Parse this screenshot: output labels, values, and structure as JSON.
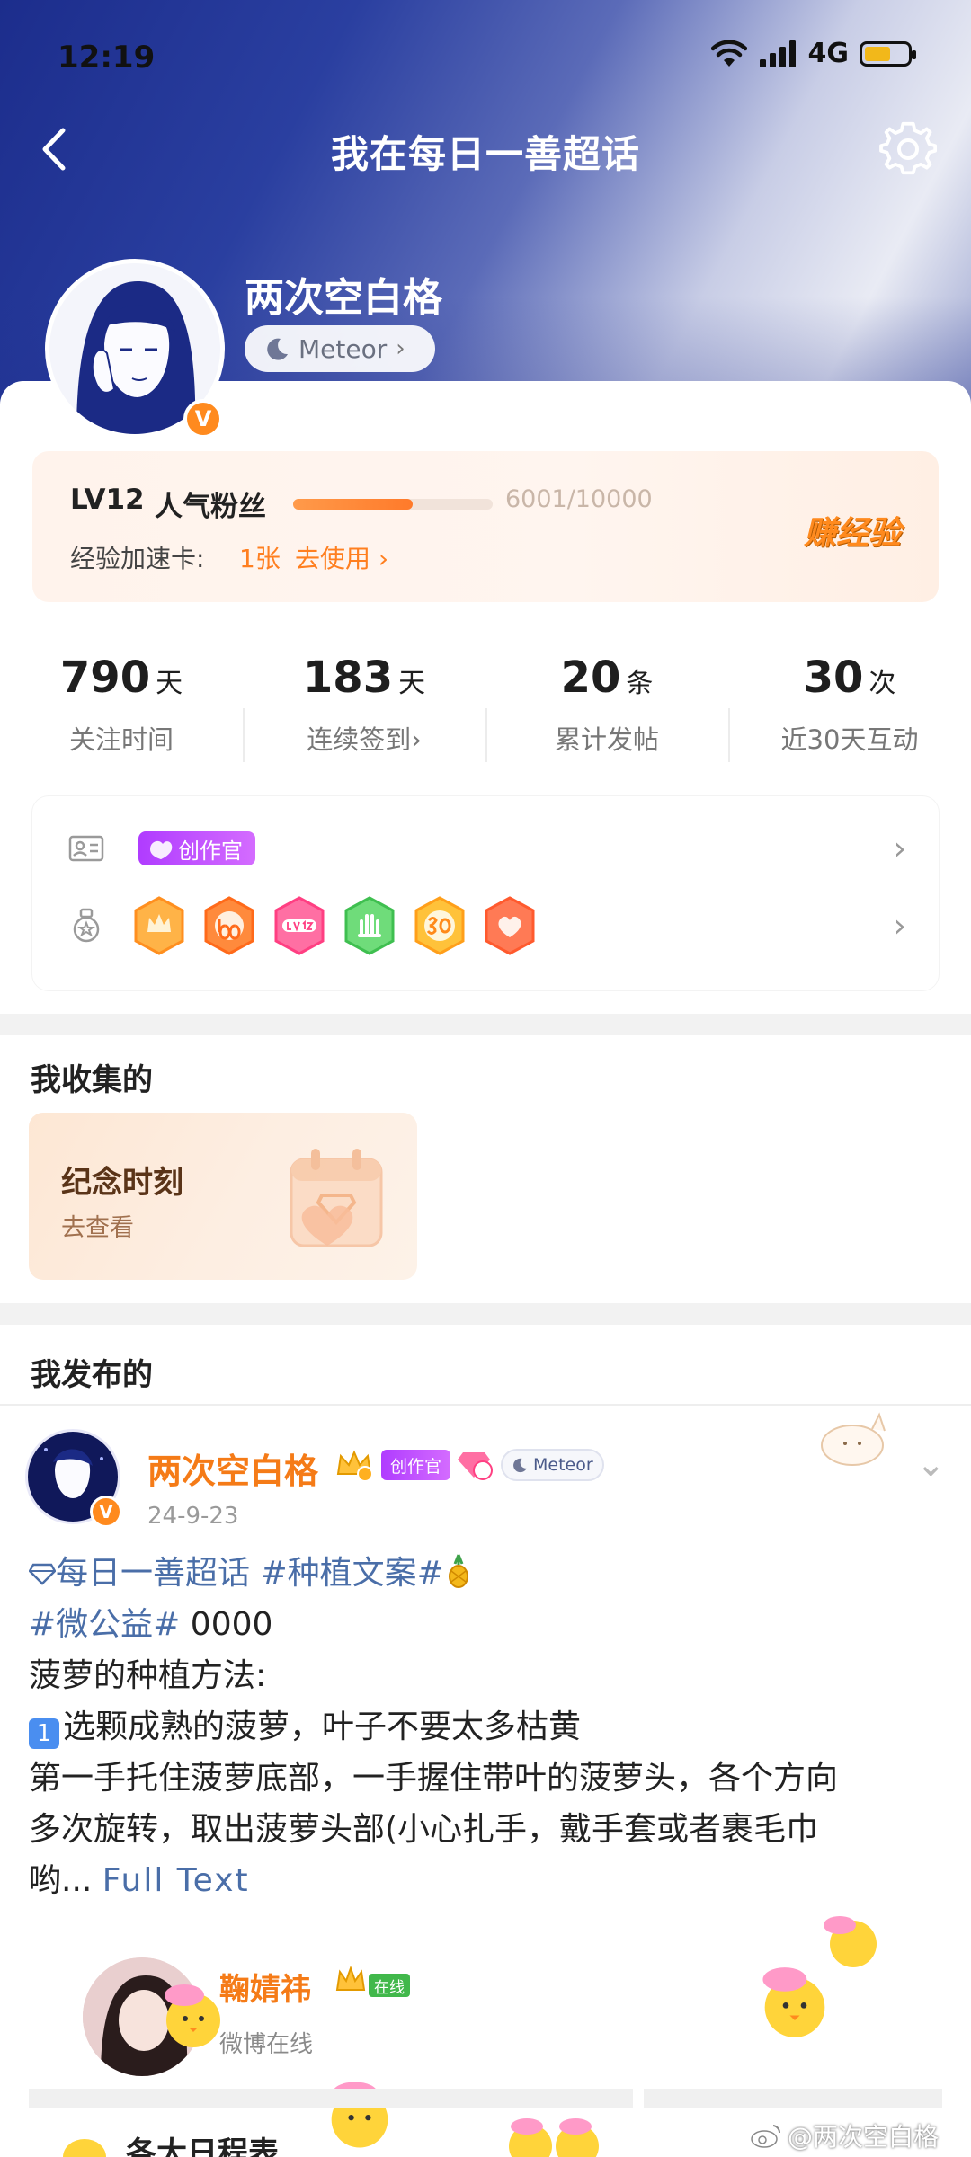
{
  "status_bar": {
    "time": "12:19",
    "network": "4G"
  },
  "nav": {
    "title": "我在每日一善超话"
  },
  "profile": {
    "name": "两次空白格",
    "badge_chip": "Meteor",
    "verify": "V"
  },
  "level": {
    "level_label": "LV12",
    "level_title": "人气粉丝",
    "progress_text": "6001/10000",
    "progress_fraction": 0.6001,
    "exp_card_label": "经验加速卡:",
    "exp_card_count": "1张",
    "exp_card_action": "去使用 ›",
    "earn_button": "赚经验"
  },
  "stats": [
    {
      "value": "790",
      "unit": "天",
      "label": "关注时间"
    },
    {
      "value": "183",
      "unit": "天",
      "label": "连续签到›"
    },
    {
      "value": "20",
      "unit": "条",
      "label": "累计发帖"
    },
    {
      "value": "30",
      "unit": "次",
      "label": "近30天互动"
    }
  ],
  "badges": {
    "creator_label": "创作官",
    "chevron": "›"
  },
  "collected": {
    "section_title": "我收集的",
    "card_title": "纪念时刻",
    "card_subtitle": "去查看"
  },
  "posted": {
    "section_title": "我发布的",
    "author": "两次空白格",
    "creator_tag": "创作官",
    "meteor_tag": "Meteor",
    "date": "24-9-23",
    "line1_tag1": "每日一善超话",
    "line1_tag2": "#种植文案#",
    "line2_tag": "#微公益#",
    "line2_text": "0000",
    "line3": "菠萝的种植方法:",
    "line4_key": "1",
    "line4": "选颗成熟的菠萝，叶子不要太多枯黄",
    "line5": "第一手托住菠萝底部，一手握住带叶的菠萝头，各个方向",
    "line6": "多次旋转，取出菠萝头部(小心扎手，戴手套或者裹毛巾",
    "line7": "哟...",
    "full_text": "Full Text"
  },
  "live": {
    "name": "鞠婧祎",
    "online_tag": "在线",
    "status": "微博在线"
  },
  "watermark": "@两次空白格",
  "bottom_partial": "各大日程表"
}
